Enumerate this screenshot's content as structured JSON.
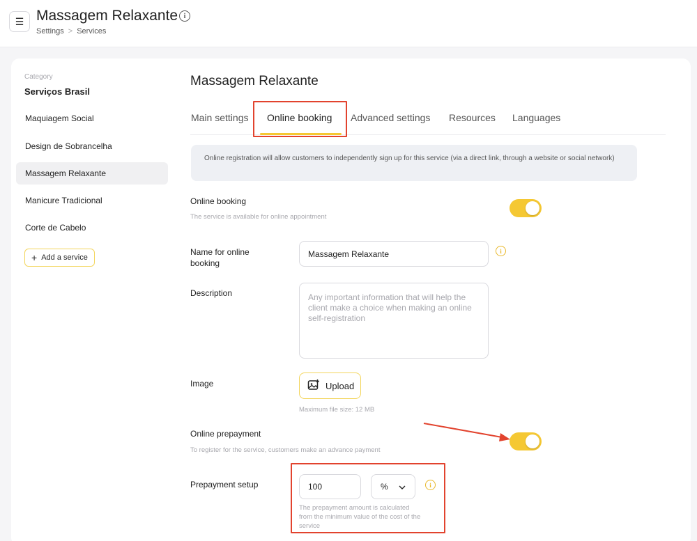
{
  "header": {
    "title": "Massagem Relaxante",
    "menu_icon": "☰",
    "info_icon": "i",
    "breadcrumb": [
      "Settings",
      "Services"
    ],
    "breadcrumb_sep": ">"
  },
  "sidebar": {
    "category_label": "Category",
    "category_name": "Serviços Brasil",
    "items": [
      {
        "label": "Maquiagem Social",
        "active": false
      },
      {
        "label": "Design de Sobrancelha",
        "active": false
      },
      {
        "label": "Massagem Relaxante",
        "active": true
      },
      {
        "label": "Manicure Tradicional",
        "active": false
      },
      {
        "label": "Corte de Cabelo",
        "active": false
      }
    ],
    "add_label": "Add a service",
    "add_icon": "+"
  },
  "main": {
    "title": "Massagem Relaxante",
    "tabs": [
      {
        "label": "Main settings",
        "active": false
      },
      {
        "label": "Online booking",
        "active": true
      },
      {
        "label": "Advanced settings",
        "active": false
      },
      {
        "label": "Resources",
        "active": false
      },
      {
        "label": "Languages",
        "active": false
      }
    ],
    "info_text": "Online registration will allow customers to independently sign up for this service (via a direct link, through a website or social network)"
  },
  "form": {
    "online_booking": {
      "label": "Online booking",
      "hint": "The service is available for online appointment",
      "enabled": true
    },
    "name": {
      "label": "Name for online booking",
      "value": "Massagem Relaxante",
      "info_icon": "i"
    },
    "description": {
      "label": "Description",
      "placeholder": "Any important information that will help the client make a choice when making an online self-registration"
    },
    "image": {
      "label": "Image",
      "button_label": "Upload",
      "hint": "Maximum file size: 12 MB"
    },
    "prepayment": {
      "label": "Online prepayment",
      "hint": "To register for the service, customers make an advance payment",
      "enabled": true
    },
    "prepayment_setup": {
      "label": "Prepayment setup",
      "amount": "100",
      "unit": "%",
      "hint": "The prepayment amount is calculated from the minimum value of the cost of the service",
      "info_icon": "i"
    }
  },
  "colors": {
    "accent": "#f5c833",
    "annotation": "#e2432e"
  }
}
